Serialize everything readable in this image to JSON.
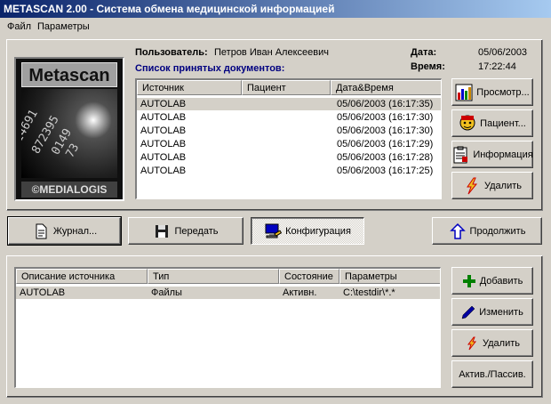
{
  "window": {
    "title": "METASCAN 2.00 - Система обмена медицинской информацией"
  },
  "menu": {
    "file": "Файл",
    "params": "Параметры"
  },
  "logo": {
    "name": "Metascan",
    "brand": "©MEDIALOGIS",
    "digits": [
      "14691",
      "872395",
      "0149",
      "73"
    ]
  },
  "user": {
    "label": "Пользователь:",
    "name": "Петров Иван Алексеевич"
  },
  "date": {
    "label": "Дата:",
    "value": "05/06/2003"
  },
  "time": {
    "label": "Время:",
    "value": "17:22:44"
  },
  "docs": {
    "title": "Список принятых документов:",
    "columns": [
      "Источник",
      "Пациент",
      "Дата&Время"
    ],
    "rows": [
      {
        "source": "AUTOLAB",
        "patient": "",
        "datetime": "05/06/2003 (16:17:35)"
      },
      {
        "source": "AUTOLAB",
        "patient": "",
        "datetime": "05/06/2003 (16:17:30)"
      },
      {
        "source": "AUTOLAB",
        "patient": "",
        "datetime": "05/06/2003 (16:17:30)"
      },
      {
        "source": "AUTOLAB",
        "patient": "",
        "datetime": "05/06/2003 (16:17:29)"
      },
      {
        "source": "AUTOLAB",
        "patient": "",
        "datetime": "05/06/2003 (16:17:28)"
      },
      {
        "source": "AUTOLAB",
        "patient": "",
        "datetime": "05/06/2003 (16:17:25)"
      }
    ]
  },
  "doc_buttons": {
    "view": "Просмотр...",
    "patient": "Пациент...",
    "info": "Информация",
    "delete": "Удалить"
  },
  "mid_buttons": {
    "journal": "Журнал...",
    "send": "Передать",
    "config": "Конфигурация",
    "continue": "Продолжить"
  },
  "sources": {
    "columns": [
      "Описание источника",
      "Тип",
      "Состояние",
      "Параметры"
    ],
    "rows": [
      {
        "desc": "AUTOLAB",
        "type": "Файлы",
        "state": "Активн.",
        "params": "C:\\testdir\\*.*"
      }
    ]
  },
  "src_buttons": {
    "add": "Добавить",
    "edit": "Изменить",
    "delete": "Удалить",
    "toggle": "Актив./Пассив."
  }
}
